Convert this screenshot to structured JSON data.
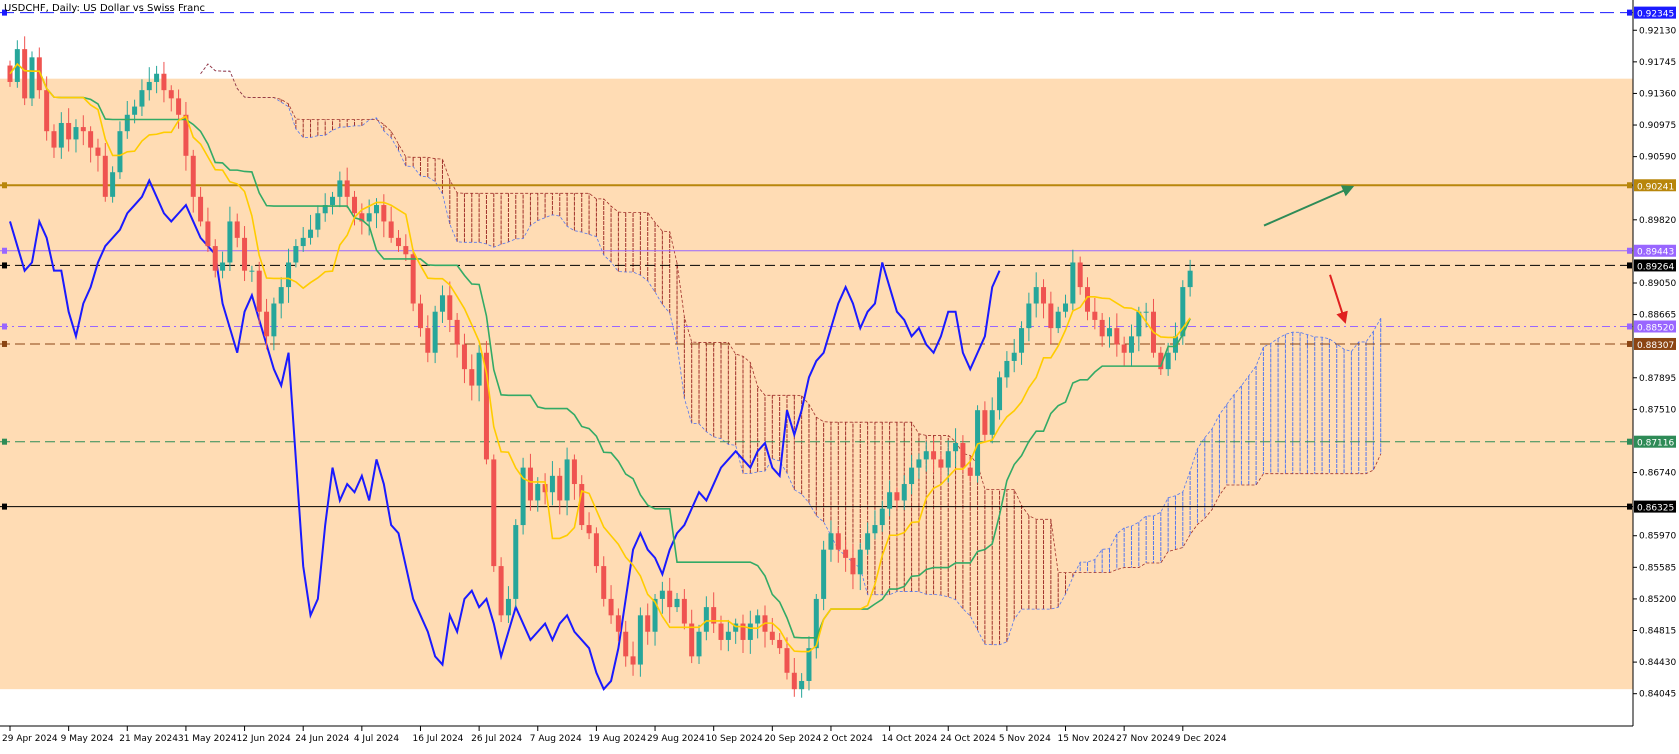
{
  "window": {
    "symbol": "USDCHF",
    "timeframe": "Daily",
    "description": "US Dollar vs Swiss Franc",
    "title_text": "USDCHF, Daily:  US Dollar vs Swiss Franc"
  },
  "chart_data": {
    "type": "candlestick",
    "title": "USDCHF, Daily:  US Dollar vs Swiss Franc",
    "ylim": [
      0.837,
      0.9245
    ],
    "price_ticks": [
      "0.92130",
      "0.91745",
      "0.91360",
      "0.90975",
      "0.90590",
      "0.89820",
      "0.89050",
      "0.88665",
      "0.87895",
      "0.87510",
      "0.86740",
      "0.85970",
      "0.85585",
      "0.85200",
      "0.84815",
      "0.84430",
      "0.84045"
    ],
    "date_ticks": [
      {
        "label": "29 Apr 2024",
        "idx": 0
      },
      {
        "label": "9 May 2024",
        "idx": 8
      },
      {
        "label": "21 May 2024",
        "idx": 16
      },
      {
        "label": "31 May 2024",
        "idx": 24
      },
      {
        "label": "12 Jun 2024",
        "idx": 32
      },
      {
        "label": "24 Jun 2024",
        "idx": 40
      },
      {
        "label": "4 Jul 2024",
        "idx": 48
      },
      {
        "label": "16 Jul 2024",
        "idx": 56
      },
      {
        "label": "26 Jul 2024",
        "idx": 64
      },
      {
        "label": "7 Aug 2024",
        "idx": 72
      },
      {
        "label": "19 Aug 2024",
        "idx": 80
      },
      {
        "label": "29 Aug 2024",
        "idx": 88
      },
      {
        "label": "10 Sep 2024",
        "idx": 96
      },
      {
        "label": "20 Sep 2024",
        "idx": 104
      },
      {
        "label": "2 Oct 2024",
        "idx": 112
      },
      {
        "label": "14 Oct 2024",
        "idx": 120
      },
      {
        "label": "24 Oct 2024",
        "idx": 128
      },
      {
        "label": "5 Nov 2024",
        "idx": 136
      },
      {
        "label": "15 Nov 2024",
        "idx": 144
      },
      {
        "label": "27 Nov 2024",
        "idx": 152
      },
      {
        "label": "9 Dec 2024",
        "idx": 160
      }
    ],
    "close": [
      0.915,
      0.919,
      0.913,
      0.918,
      0.914,
      0.909,
      0.907,
      0.91,
      0.908,
      0.9095,
      0.909,
      0.907,
      0.906,
      0.901,
      0.904,
      0.909,
      0.911,
      0.912,
      0.914,
      0.915,
      0.916,
      0.914,
      0.913,
      0.911,
      0.906,
      0.901,
      0.898,
      0.895,
      0.892,
      0.893,
      0.898,
      0.896,
      0.892,
      0.892,
      0.887,
      0.884,
      0.888,
      0.89,
      0.893,
      0.895,
      0.896,
      0.897,
      0.899,
      0.9,
      0.901,
      0.903,
      0.901,
      0.899,
      0.898,
      0.899,
      0.9,
      0.898,
      0.896,
      0.895,
      0.894,
      0.888,
      0.885,
      0.882,
      0.887,
      0.889,
      0.886,
      0.883,
      0.88,
      0.878,
      0.882,
      0.869,
      0.856,
      0.85,
      0.852,
      0.861,
      0.868,
      0.864,
      0.866,
      0.865,
      0.867,
      0.864,
      0.869,
      0.866,
      0.861,
      0.86,
      0.856,
      0.852,
      0.85,
      0.848,
      0.845,
      0.844,
      0.85,
      0.848,
      0.852,
      0.853,
      0.851,
      0.852,
      0.849,
      0.845,
      0.848,
      0.851,
      0.849,
      0.847,
      0.848,
      0.849,
      0.847,
      0.849,
      0.85,
      0.848,
      0.847,
      0.846,
      0.843,
      0.841,
      0.842,
      0.846,
      0.852,
      0.858,
      0.86,
      0.858,
      0.857,
      0.855,
      0.858,
      0.86,
      0.861,
      0.863,
      0.865,
      0.864,
      0.866,
      0.868,
      0.869,
      0.87,
      0.869,
      0.868,
      0.87,
      0.871,
      0.868,
      0.867,
      0.875,
      0.872,
      0.875,
      0.879,
      0.881,
      0.882,
      0.885,
      0.888,
      0.89,
      0.888,
      0.885,
      0.887,
      0.888,
      0.893,
      0.89,
      0.887,
      0.886,
      0.884,
      0.885,
      0.883,
      0.882,
      0.884,
      0.887,
      0.887,
      0.882,
      0.88,
      0.882,
      0.884,
      0.89,
      0.892
    ],
    "series": [
      {
        "name": "Tenkan-sen",
        "color": "#ffcc00"
      },
      {
        "name": "Kijun-sen",
        "color": "#33aa66"
      },
      {
        "name": "Chikou Span",
        "color": "#1a1aff"
      }
    ],
    "horizontal_levels": [
      {
        "price": 0.92345,
        "label": "0.92345",
        "color": "#1a1aff",
        "style": "dash-long",
        "label_bg": "#1a1aff"
      },
      {
        "price": 0.90241,
        "label": "0.90241",
        "color": "#b8860b",
        "style": "solid-thick",
        "label_bg": "#b8860b"
      },
      {
        "price": 0.89443,
        "label": "0.89443",
        "color": "#9966ff",
        "style": "solid",
        "label_bg": "#9966ff"
      },
      {
        "price": 0.89264,
        "label": "0.89264",
        "color": "#000000",
        "style": "dash",
        "label_bg": "#000000"
      },
      {
        "price": 0.8852,
        "label": "0.88520",
        "color": "#9966ff",
        "style": "dashdot",
        "label_bg": "#9966ff"
      },
      {
        "price": 0.88307,
        "label": "0.88307",
        "color": "#8b4513",
        "style": "dash",
        "label_bg": "#8b4513"
      },
      {
        "price": 0.87116,
        "label": "0.87116",
        "color": "#2e8b57",
        "style": "dash",
        "label_bg": "#2e8b57"
      },
      {
        "price": 0.86325,
        "label": "0.86325",
        "color": "#000000",
        "style": "solid",
        "label_bg": "#000000"
      }
    ],
    "zone": {
      "top": 0.9154,
      "bottom": 0.841,
      "color": "#ffdcb4"
    },
    "colors": {
      "bull": "#26a69a",
      "bear": "#ef5350",
      "cloud_bull": "#5577ee",
      "cloud_bear": "#a0302a",
      "arrow_up": "#2e8b57",
      "arrow_down": "#e02020"
    }
  }
}
